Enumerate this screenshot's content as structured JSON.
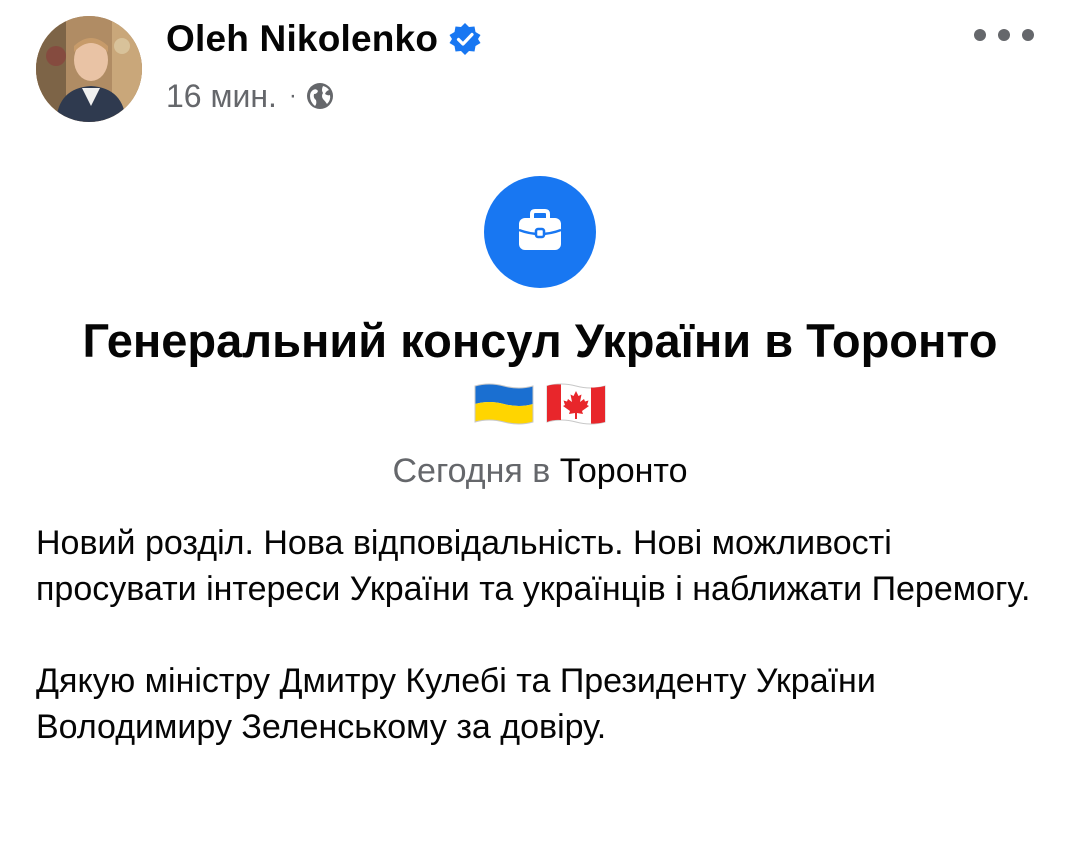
{
  "author": {
    "name": "Oleh Nikolenko",
    "verified": true
  },
  "meta": {
    "time": "16 мин.",
    "separator": "·",
    "audience_icon": "globe-icon"
  },
  "menu": {
    "icon": "more-horizontal-icon"
  },
  "life_event": {
    "icon": "briefcase-icon",
    "icon_color": "#1877f2",
    "title": "Генеральний консул України в Торонто",
    "flags": [
      "ukraine-flag",
      "canada-flag"
    ],
    "subtitle_prefix": "Сегодня в",
    "subtitle_place": "Торонто"
  },
  "post": {
    "paragraphs": [
      "Новий розділ. Нова відповідальність. Нові можливості просувати інтереси України та українців і наближати Перемогу.",
      "Дякую міністру Дмитру Кулебі та Президенту України Володимиру Зеленському за довіру."
    ]
  },
  "colors": {
    "primary_text": "#050505",
    "secondary_text": "#65676b",
    "accent": "#1877f2"
  }
}
